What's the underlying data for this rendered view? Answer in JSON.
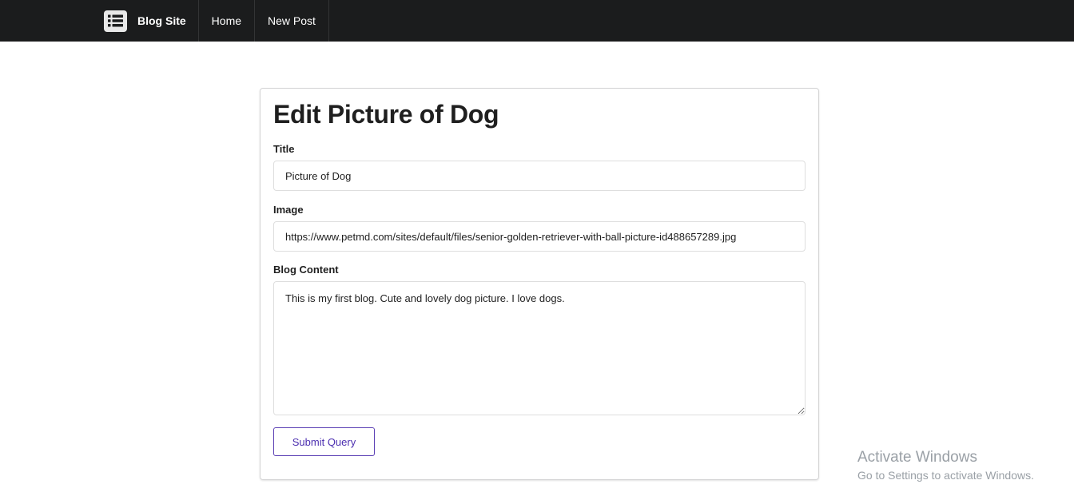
{
  "navbar": {
    "brand_label": "Blog Site",
    "brand_icon": "list-icon",
    "items": [
      {
        "label": "Home"
      },
      {
        "label": "New Post"
      }
    ]
  },
  "form": {
    "title": "Edit Picture of Dog",
    "fields": {
      "title": {
        "label": "Title",
        "value": "Picture of Dog"
      },
      "image": {
        "label": "Image",
        "value": "https://www.petmd.com/sites/default/files/senior-golden-retriever-with-ball-picture-id488657289.jpg"
      },
      "content": {
        "label": "Blog Content",
        "value": "This is my first blog. Cute and lovely dog picture. I love dogs."
      }
    },
    "submit_label": "Submit Query"
  },
  "watermark": {
    "title": "Activate Windows",
    "subtitle": "Go to Settings to activate Windows."
  },
  "colors": {
    "navbar_bg": "#1b1c1d",
    "accent": "#4c2fb0"
  }
}
